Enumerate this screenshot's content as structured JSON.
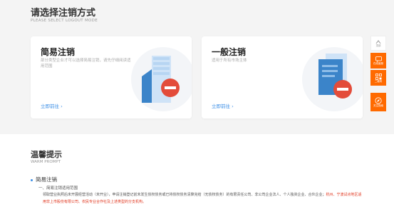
{
  "header": {
    "title": "请选择注销方式",
    "subtitle": "PLEASE SELECT LOGOUT MODE"
  },
  "cards": [
    {
      "title": "简易注销",
      "desc": "部分类型企业才可以选择简易注销，请先仔细阅读适用范围",
      "link": "立即前往 ›"
    },
    {
      "title": "一般注销",
      "desc": "适用于所有市场主体",
      "link": "立即前往 ›"
    }
  ],
  "side_toolbar": [
    {
      "label": "顶部",
      "icon": "arrow-up-icon"
    },
    {
      "label": "在线客服",
      "icon": "chat-icon"
    },
    {
      "label": "二维码",
      "icon": "qrcode-icon"
    },
    {
      "label": "关注指南",
      "icon": "compass-icon"
    }
  ],
  "tips": {
    "title": "温馨提示",
    "subtitle": "WARM PROMPT",
    "section": "简易注销",
    "item": "一、简易注销适用范围",
    "para_main": "领取营业执照后未开展经营活动（未开业），申请注销登记前未发生债权债务或已将债权债务清算完结（无债权债务）的有限责任公司、非公司企业法人、个人独资企业、合伙企业；",
    "para_red": "杭州、宁波试点地区适用非上市股份有限公司、农民专业合作社及上述类型的分支机构。"
  },
  "colors": {
    "accent": "#ff6a00",
    "link": "#3a8ee6",
    "danger": "#e34c3a"
  }
}
